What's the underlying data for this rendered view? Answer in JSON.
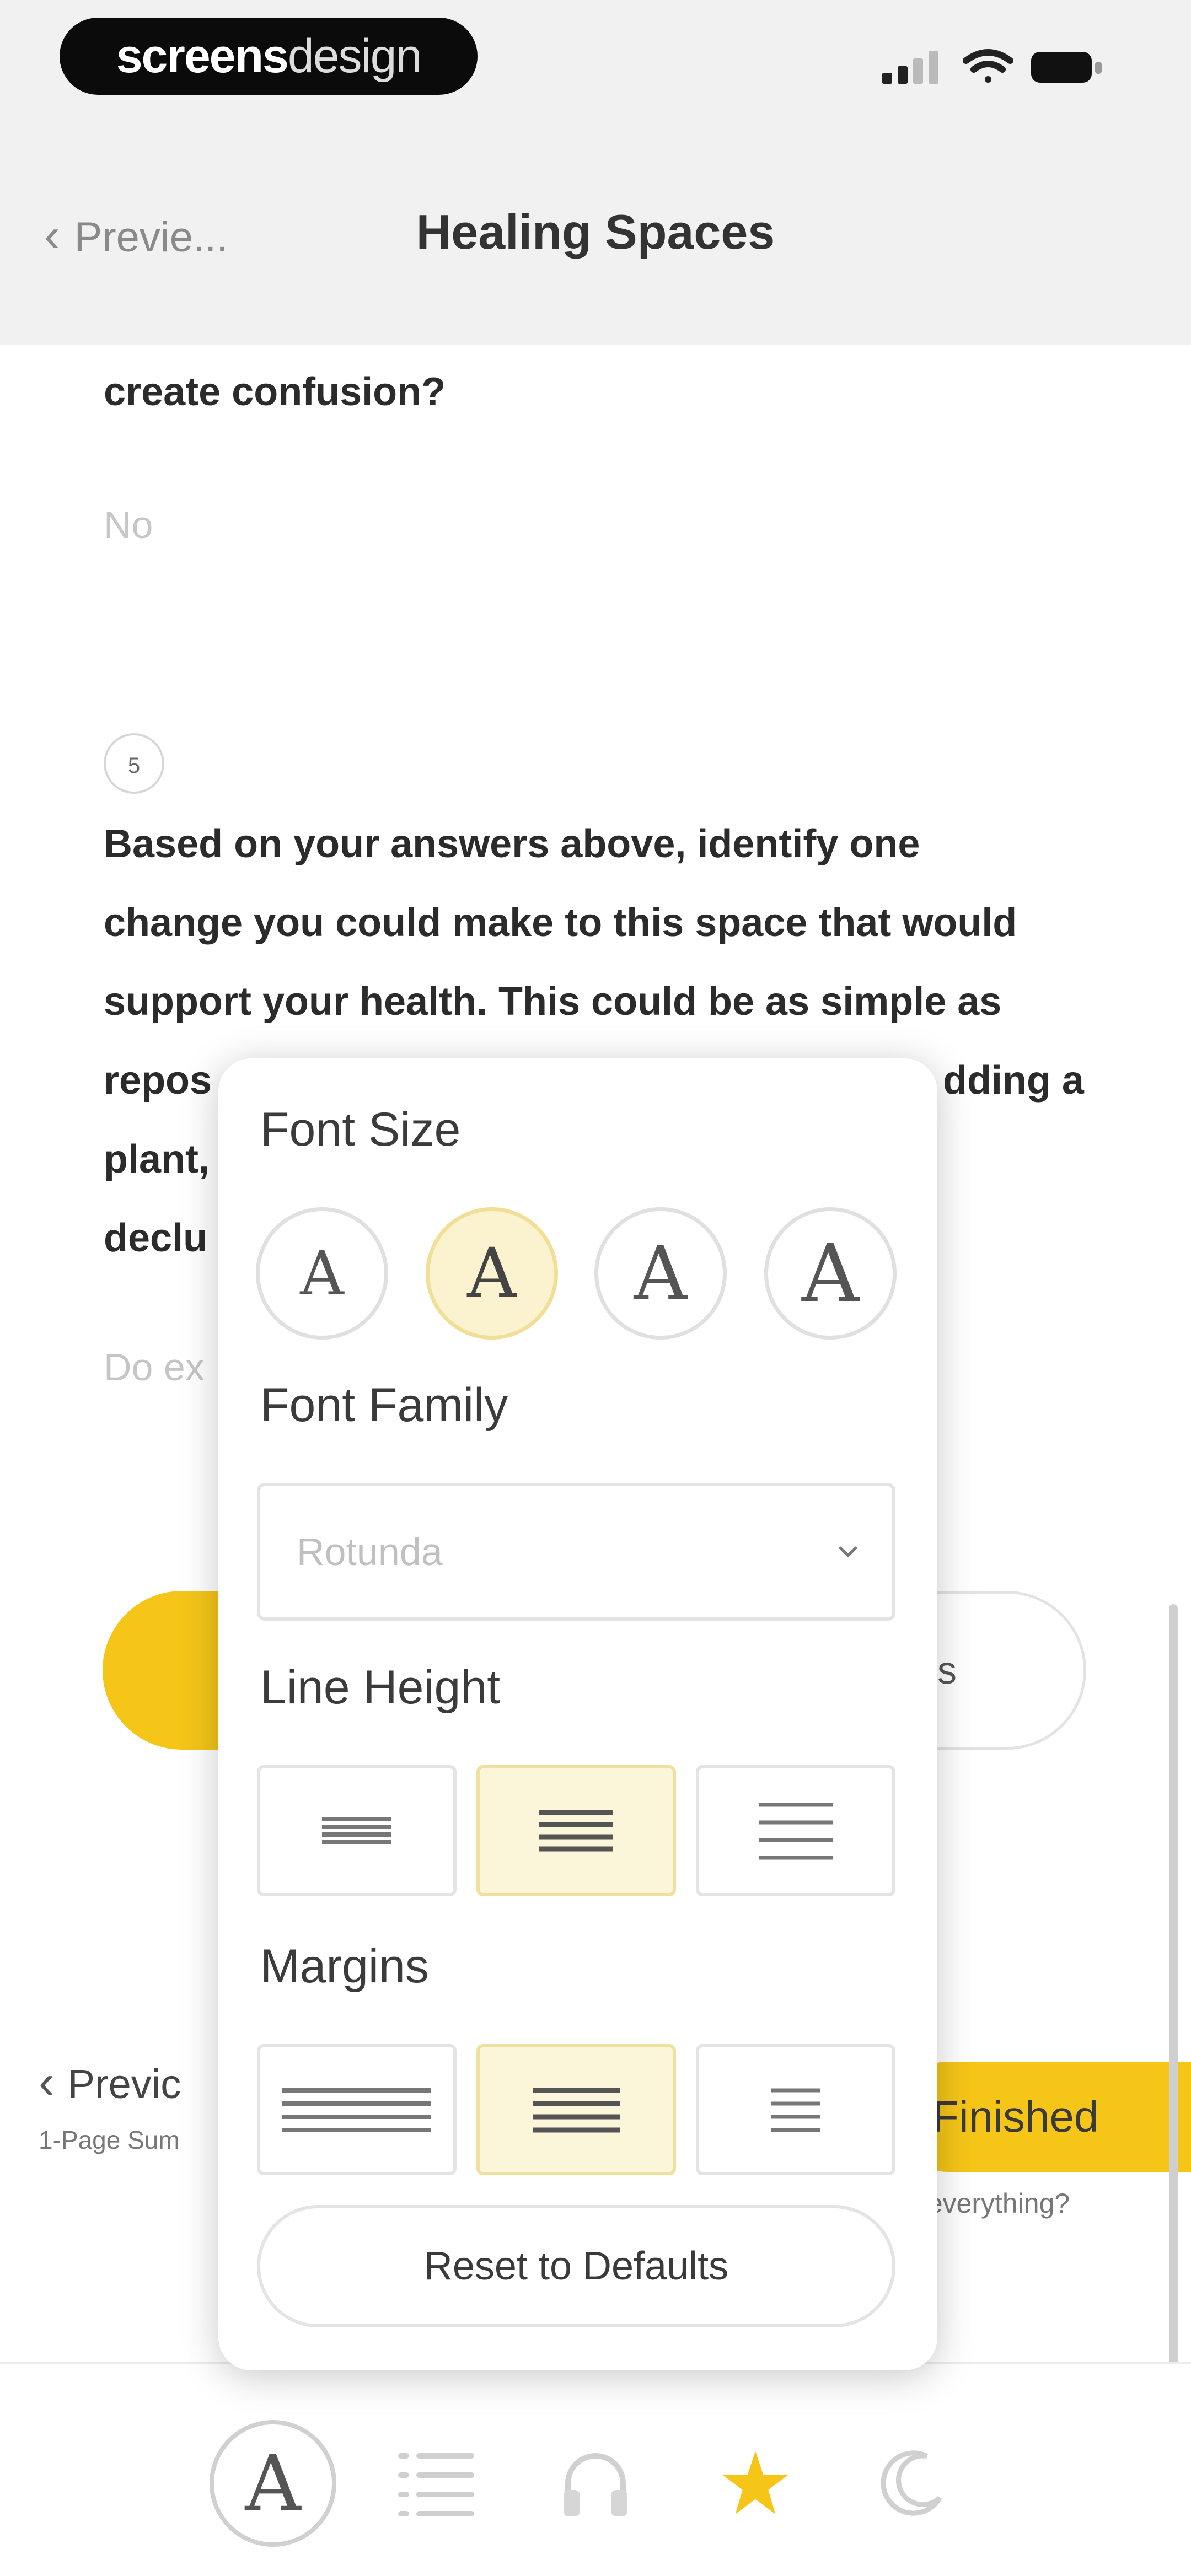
{
  "brand": {
    "part1": "screens",
    "part2": "design"
  },
  "header": {
    "back_label": "Previe...",
    "title": "Healing Spaces"
  },
  "content": {
    "q4_tail": "create confusion?",
    "q4_answer": "No",
    "q5_number": "5",
    "q5_lines": [
      "Based on your answers above, identify one",
      "change you could make to this space that would",
      "support your health. This could be as simple as",
      "repos",
      "plant,",
      "declu"
    ],
    "q5_line4_tail": "dding a",
    "q5_placeholder": "Do ex",
    "next_label": "s"
  },
  "footer_nav": {
    "prev_label": "Previc",
    "prev_sub": "1-Page Sum",
    "finished_label": "Finished",
    "finished_sub": "d everything?"
  },
  "popover": {
    "font_size_label": "Font Size",
    "size_glyph": "A",
    "selected_size_index": 1,
    "font_family_label": "Font Family",
    "font_family_value": "Rotunda",
    "line_height_label": "Line Height",
    "selected_line_height_index": 1,
    "margins_label": "Margins",
    "selected_margin_index": 1,
    "reset_label": "Reset to Defaults"
  },
  "tabbar": {
    "font_glyph": "A",
    "items": [
      "font-settings",
      "table-of-contents",
      "audio",
      "favorite",
      "night-mode"
    ],
    "favorite_color": "#f5c518"
  },
  "colors": {
    "accent": "#f5c518",
    "header_bg": "#f1f1f1"
  }
}
